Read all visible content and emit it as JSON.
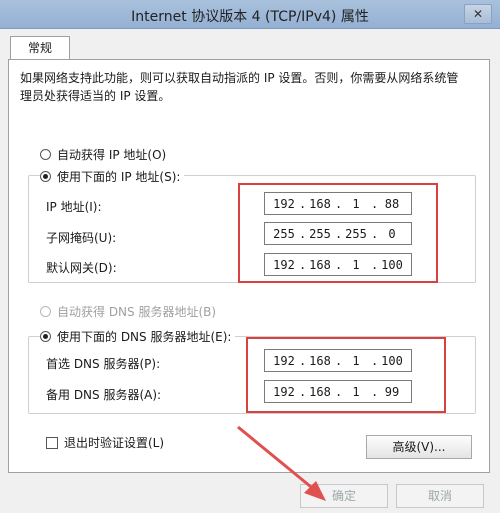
{
  "window": {
    "title": "Internet 协议版本 4 (TCP/IPv4) 属性",
    "close_glyph": "✕"
  },
  "tabs": [
    {
      "label": "常规"
    }
  ],
  "description": "如果网络支持此功能，则可以获取自动指派的 IP 设置。否则，你需要从网络系统管理员处获得适当的 IP 设置。",
  "ip_section": {
    "auto_option": "自动获得 IP 地址(O)",
    "manual_option": "使用下面的 IP 地址(S):",
    "fields": [
      {
        "label": "IP 地址(I):",
        "octets": [
          "192",
          "168",
          "1",
          "88"
        ]
      },
      {
        "label": "子网掩码(U):",
        "octets": [
          "255",
          "255",
          "255",
          "0"
        ]
      },
      {
        "label": "默认网关(D):",
        "octets": [
          "192",
          "168",
          "1",
          "100"
        ]
      }
    ]
  },
  "dns_section": {
    "auto_option": "自动获得 DNS 服务器地址(B)",
    "manual_option": "使用下面的 DNS 服务器地址(E):",
    "fields": [
      {
        "label": "首选 DNS 服务器(P):",
        "octets": [
          "192",
          "168",
          "1",
          "100"
        ]
      },
      {
        "label": "备用 DNS 服务器(A):",
        "octets": [
          "192",
          "168",
          "1",
          "99"
        ]
      }
    ]
  },
  "validate_on_exit": "退出时验证设置(L)",
  "buttons": {
    "advanced": "高级(V)...",
    "ok": "确定",
    "cancel": "取消"
  },
  "colors": {
    "highlight_box": "#d9403f",
    "arrow": "#e0504f"
  }
}
